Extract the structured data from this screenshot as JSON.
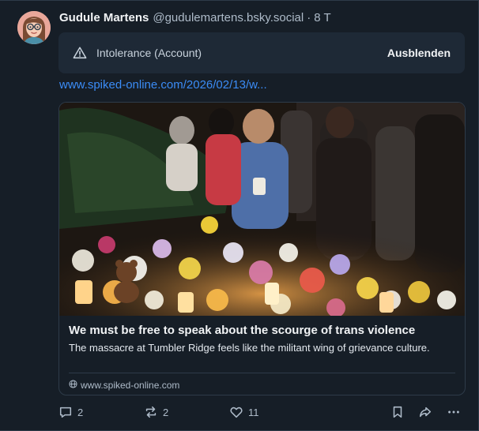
{
  "post": {
    "author": {
      "display_name": "Gudule Martens",
      "handle": "@gudulemartens.bsky.social",
      "separator": "·",
      "time_ago": "8 T"
    },
    "content_label": {
      "text": "Intolerance (Account)",
      "hide_label": "Ausblenden"
    },
    "link_text": "www.spiked-online.com/2026/02/13/w...",
    "embed": {
      "title": "We must be free to speak about the scourge of trans violence",
      "description": "The massacre at Tumbler Ridge feels like the militant wing of grievance culture.",
      "domain": "www.spiked-online.com"
    },
    "actions": {
      "reply_count": "2",
      "repost_count": "2",
      "like_count": "11"
    }
  },
  "colors": {
    "background": "#161e27",
    "link": "#3b8cf6",
    "muted_text": "#aebbc9",
    "border": "#2e3b49"
  },
  "icons": [
    "warning-icon",
    "globe-icon",
    "reply-icon",
    "repost-icon",
    "like-icon",
    "bookmark-icon",
    "share-icon",
    "more-icon"
  ]
}
